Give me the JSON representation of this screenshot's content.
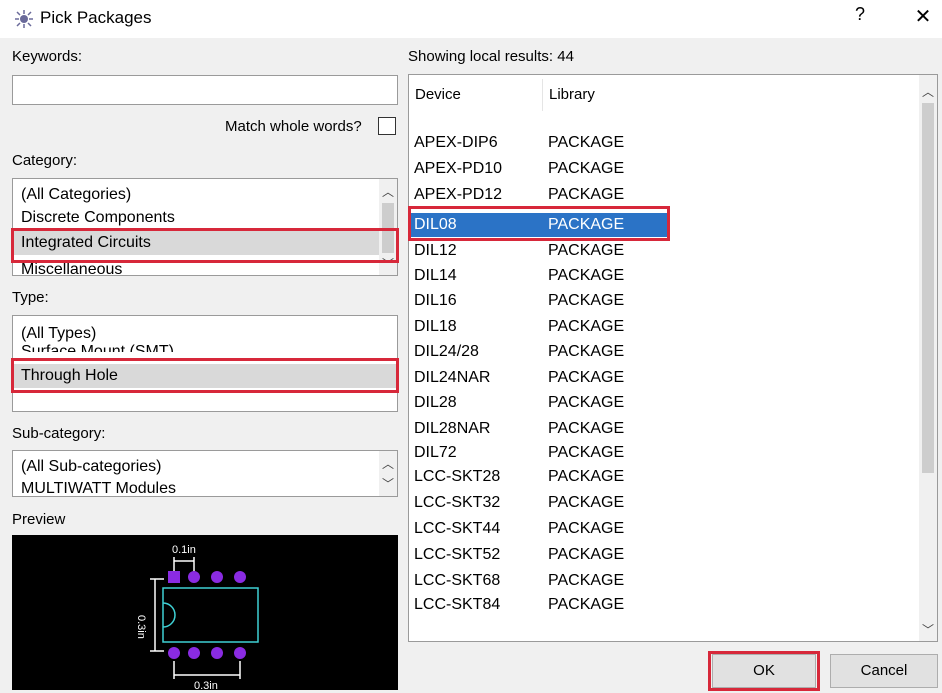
{
  "window": {
    "title": "Pick Packages",
    "help": "?",
    "close": "✕"
  },
  "keywords": {
    "label": "Keywords:",
    "value": "",
    "match_whole_words": "Match whole words?"
  },
  "category": {
    "label": "Category:",
    "items": [
      "(All Categories)",
      "Discrete Components",
      "Integrated Circuits",
      "Miscellaneous"
    ],
    "selected": "Integrated Circuits"
  },
  "type": {
    "label": "Type:",
    "items": [
      "(All Types)",
      "Surface Mount (SMT)",
      "Through Hole"
    ],
    "selected": "Through Hole"
  },
  "subcategory": {
    "label": "Sub-category:",
    "items": [
      "(All Sub-categories)",
      "MULTIWATT Modules"
    ]
  },
  "preview": {
    "label": "Preview",
    "dim_top": "0.1in",
    "dim_side": "0.3in",
    "dim_bottom": "0.3in"
  },
  "results": {
    "header": "Showing local results: 44",
    "columns": [
      "Device",
      "Library"
    ],
    "rows": [
      {
        "device": "APEX-DIP6",
        "library": "PACKAGE"
      },
      {
        "device": "APEX-PD10",
        "library": "PACKAGE"
      },
      {
        "device": "APEX-PD12",
        "library": "PACKAGE"
      },
      {
        "device": "DIL08",
        "library": "PACKAGE"
      },
      {
        "device": "DIL12",
        "library": "PACKAGE"
      },
      {
        "device": "DIL14",
        "library": "PACKAGE"
      },
      {
        "device": "DIL16",
        "library": "PACKAGE"
      },
      {
        "device": "DIL18",
        "library": "PACKAGE"
      },
      {
        "device": "DIL24/28",
        "library": "PACKAGE"
      },
      {
        "device": "DIL24NAR",
        "library": "PACKAGE"
      },
      {
        "device": "DIL28",
        "library": "PACKAGE"
      },
      {
        "device": "DIL28NAR",
        "library": "PACKAGE"
      },
      {
        "device": "DIL72",
        "library": "PACKAGE"
      },
      {
        "device": "LCC-SKT28",
        "library": "PACKAGE"
      },
      {
        "device": "LCC-SKT32",
        "library": "PACKAGE"
      },
      {
        "device": "LCC-SKT44",
        "library": "PACKAGE"
      },
      {
        "device": "LCC-SKT52",
        "library": "PACKAGE"
      },
      {
        "device": "LCC-SKT68",
        "library": "PACKAGE"
      },
      {
        "device": "LCC-SKT84",
        "library": "PACKAGE"
      }
    ],
    "selected": "DIL08"
  },
  "buttons": {
    "ok": "OK",
    "cancel": "Cancel"
  },
  "colors": {
    "highlight": "#d7283a",
    "selection": "#2b73c6",
    "pad": "#8a2be2",
    "outline": "#3fd0d4"
  }
}
